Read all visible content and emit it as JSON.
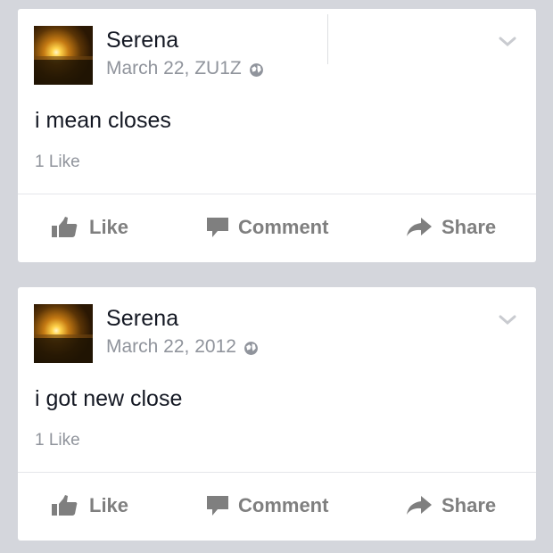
{
  "posts": [
    {
      "author": "Serena",
      "date": "March 22, ZU1Z",
      "text": "i mean closes",
      "likes": "1 Like",
      "actions": {
        "like": "Like",
        "comment": "Comment",
        "share": "Share"
      }
    },
    {
      "author": "Serena",
      "date": "March 22, 2012",
      "text": "i got new close",
      "likes": "1 Like",
      "actions": {
        "like": "Like",
        "comment": "Comment",
        "share": "Share"
      }
    }
  ],
  "icons": {
    "privacy": "globe-icon",
    "menu": "chevron-down-icon",
    "like": "thumbs-up-icon",
    "comment": "speech-bubble-icon",
    "share": "share-arrow-icon"
  },
  "colors": {
    "background": "#d4d6dc",
    "card": "#ffffff",
    "text": "#141823",
    "meta": "#90949c",
    "action": "#7f7f7f"
  }
}
